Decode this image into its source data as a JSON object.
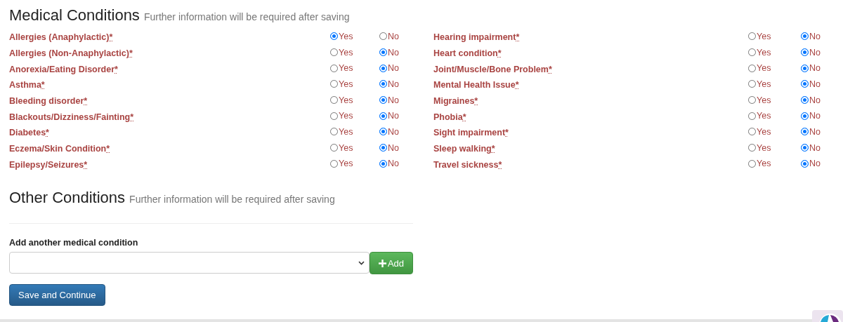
{
  "medical_section": {
    "title": "Medical Conditions",
    "subtitle": "Further information will be required after saving"
  },
  "medical_conditions": [
    {
      "label": "Allergies (Anaphylactic)",
      "required_mark": "*",
      "options": [
        {
          "label": "Yes",
          "selected": true
        },
        {
          "label": "No",
          "selected": false
        }
      ]
    },
    {
      "label": "Allergies (Non-Anaphylactic)",
      "required_mark": "*",
      "options": [
        {
          "label": "Yes",
          "selected": false
        },
        {
          "label": "No",
          "selected": true
        }
      ]
    },
    {
      "label": "Anorexia/Eating Disorder",
      "required_mark": "*",
      "options": [
        {
          "label": "Yes",
          "selected": false
        },
        {
          "label": "No",
          "selected": true
        }
      ]
    },
    {
      "label": "Asthma",
      "required_mark": "*",
      "options": [
        {
          "label": "Yes",
          "selected": false
        },
        {
          "label": "No",
          "selected": true
        }
      ]
    },
    {
      "label": "Bleeding disorder",
      "required_mark": "*",
      "options": [
        {
          "label": "Yes",
          "selected": false
        },
        {
          "label": "No",
          "selected": true
        }
      ]
    },
    {
      "label": "Blackouts/Dizziness/Fainting",
      "required_mark": "*",
      "options": [
        {
          "label": "Yes",
          "selected": false
        },
        {
          "label": "No",
          "selected": true
        }
      ]
    },
    {
      "label": "Diabetes",
      "required_mark": "*",
      "options": [
        {
          "label": "Yes",
          "selected": false
        },
        {
          "label": "No",
          "selected": true
        }
      ]
    },
    {
      "label": "Eczema/Skin Condition",
      "required_mark": "*",
      "options": [
        {
          "label": "Yes",
          "selected": false
        },
        {
          "label": "No",
          "selected": true
        }
      ]
    },
    {
      "label": "Epilepsy/Seizures",
      "required_mark": "*",
      "options": [
        {
          "label": "Yes",
          "selected": false
        },
        {
          "label": "No",
          "selected": true
        }
      ]
    },
    {
      "label": "Hearing impairment",
      "required_mark": "*",
      "options": [
        {
          "label": "Yes",
          "selected": false
        },
        {
          "label": "No",
          "selected": true
        }
      ]
    },
    {
      "label": "Heart condition",
      "required_mark": "*",
      "options": [
        {
          "label": "Yes",
          "selected": false
        },
        {
          "label": "No",
          "selected": true
        }
      ]
    },
    {
      "label": "Joint/Muscle/Bone Problem",
      "required_mark": "*",
      "options": [
        {
          "label": "Yes",
          "selected": false
        },
        {
          "label": "No",
          "selected": true
        }
      ]
    },
    {
      "label": "Mental Health Issue",
      "required_mark": "*",
      "options": [
        {
          "label": "Yes",
          "selected": false
        },
        {
          "label": "No",
          "selected": true
        }
      ]
    },
    {
      "label": "Migraines",
      "required_mark": "*",
      "options": [
        {
          "label": "Yes",
          "selected": false
        },
        {
          "label": "No",
          "selected": true
        }
      ]
    },
    {
      "label": "Phobia",
      "required_mark": "*",
      "options": [
        {
          "label": "Yes",
          "selected": false
        },
        {
          "label": "No",
          "selected": true
        }
      ]
    },
    {
      "label": "Sight impairment",
      "required_mark": "*",
      "options": [
        {
          "label": "Yes",
          "selected": false
        },
        {
          "label": "No",
          "selected": true
        }
      ]
    },
    {
      "label": "Sleep walking",
      "required_mark": "*",
      "options": [
        {
          "label": "Yes",
          "selected": false
        },
        {
          "label": "No",
          "selected": true
        }
      ]
    },
    {
      "label": "Travel sickness",
      "required_mark": "*",
      "options": [
        {
          "label": "Yes",
          "selected": false
        },
        {
          "label": "No",
          "selected": true
        }
      ]
    }
  ],
  "other_section": {
    "title": "Other Conditions",
    "subtitle": "Further information will be required after saving"
  },
  "add_condition": {
    "label": "Add another medical condition",
    "add_button": "Add"
  },
  "save_button": "Save and Continue"
}
